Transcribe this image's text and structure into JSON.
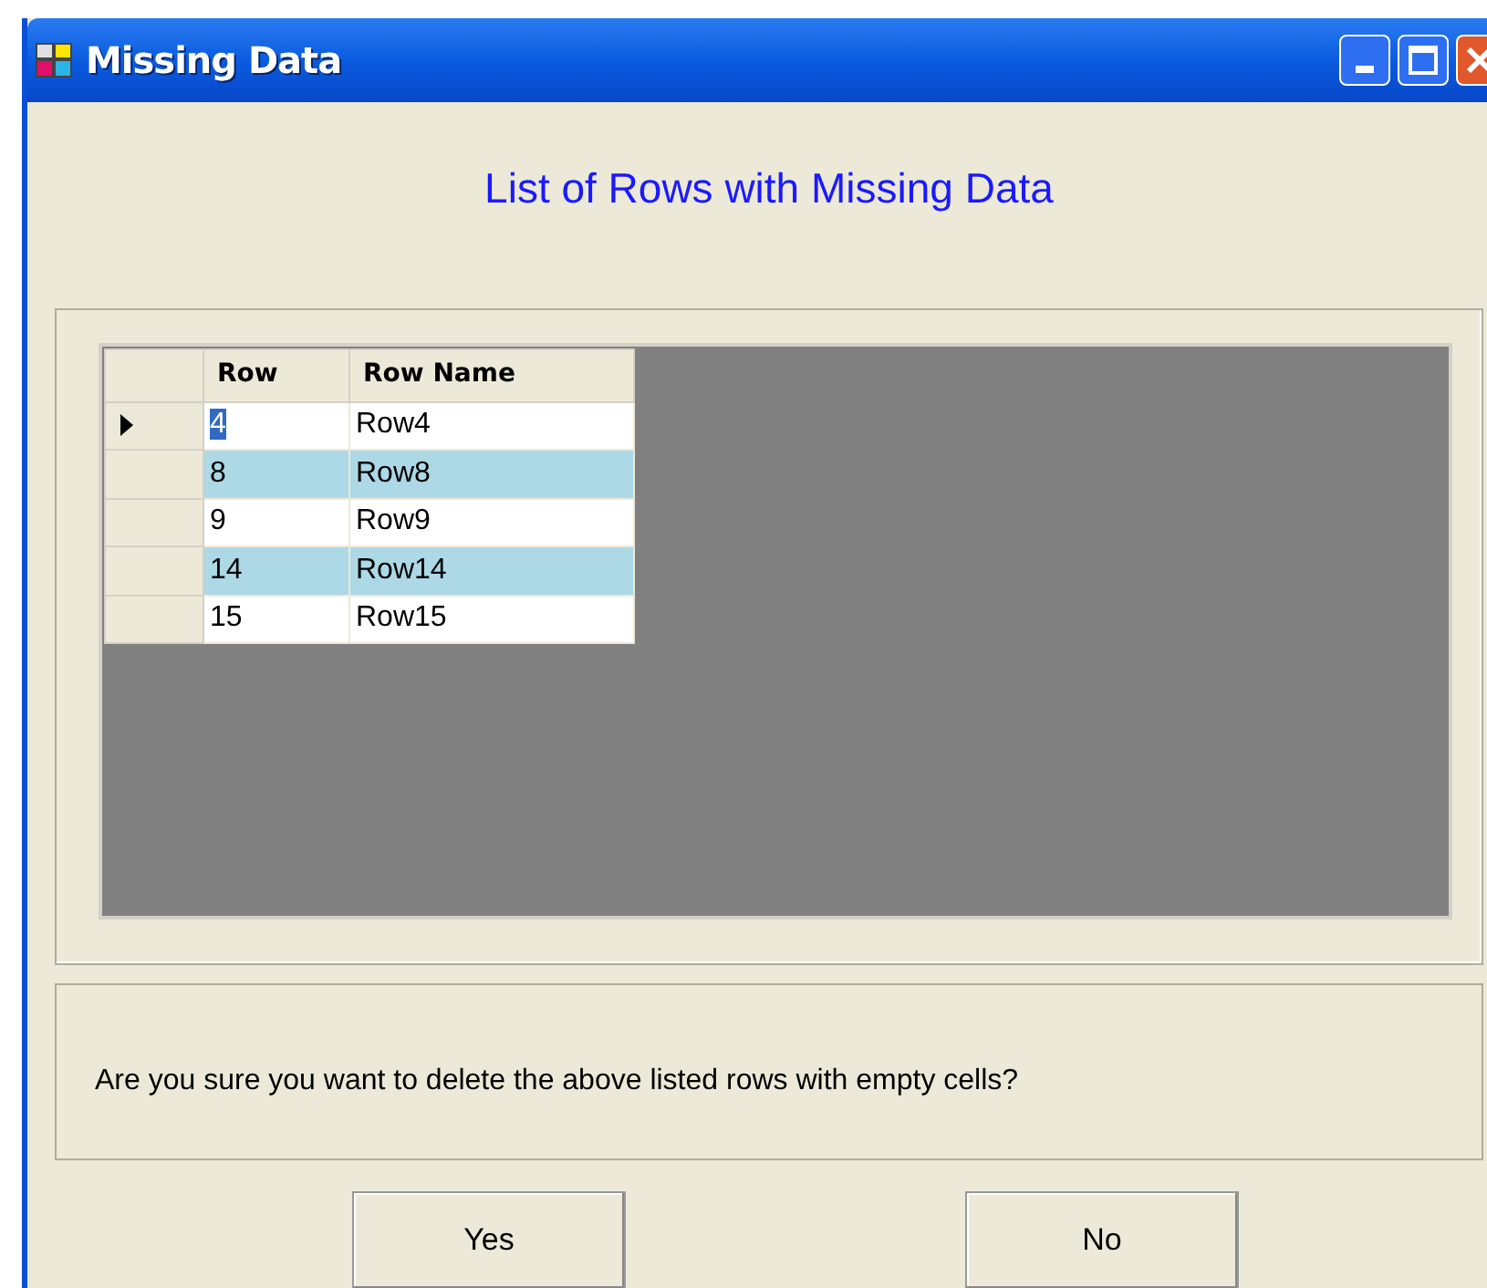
{
  "window": {
    "title": "Missing Data"
  },
  "heading": "List of Rows with Missing Data",
  "table": {
    "columns": [
      "Row",
      "Row Name"
    ],
    "rows": [
      {
        "cells": [
          "4",
          "Row4"
        ],
        "current": true,
        "selected": true
      },
      {
        "cells": [
          "8",
          "Row8"
        ],
        "current": false,
        "selected": false
      },
      {
        "cells": [
          "9",
          "Row9"
        ],
        "current": false,
        "selected": false
      },
      {
        "cells": [
          "14",
          "Row14"
        ],
        "current": false,
        "selected": false
      },
      {
        "cells": [
          "15",
          "Row15"
        ],
        "current": false,
        "selected": false
      }
    ]
  },
  "message": "Are you sure you want to delete the above listed rows with empty cells?",
  "buttons": [
    "Yes",
    "No"
  ]
}
